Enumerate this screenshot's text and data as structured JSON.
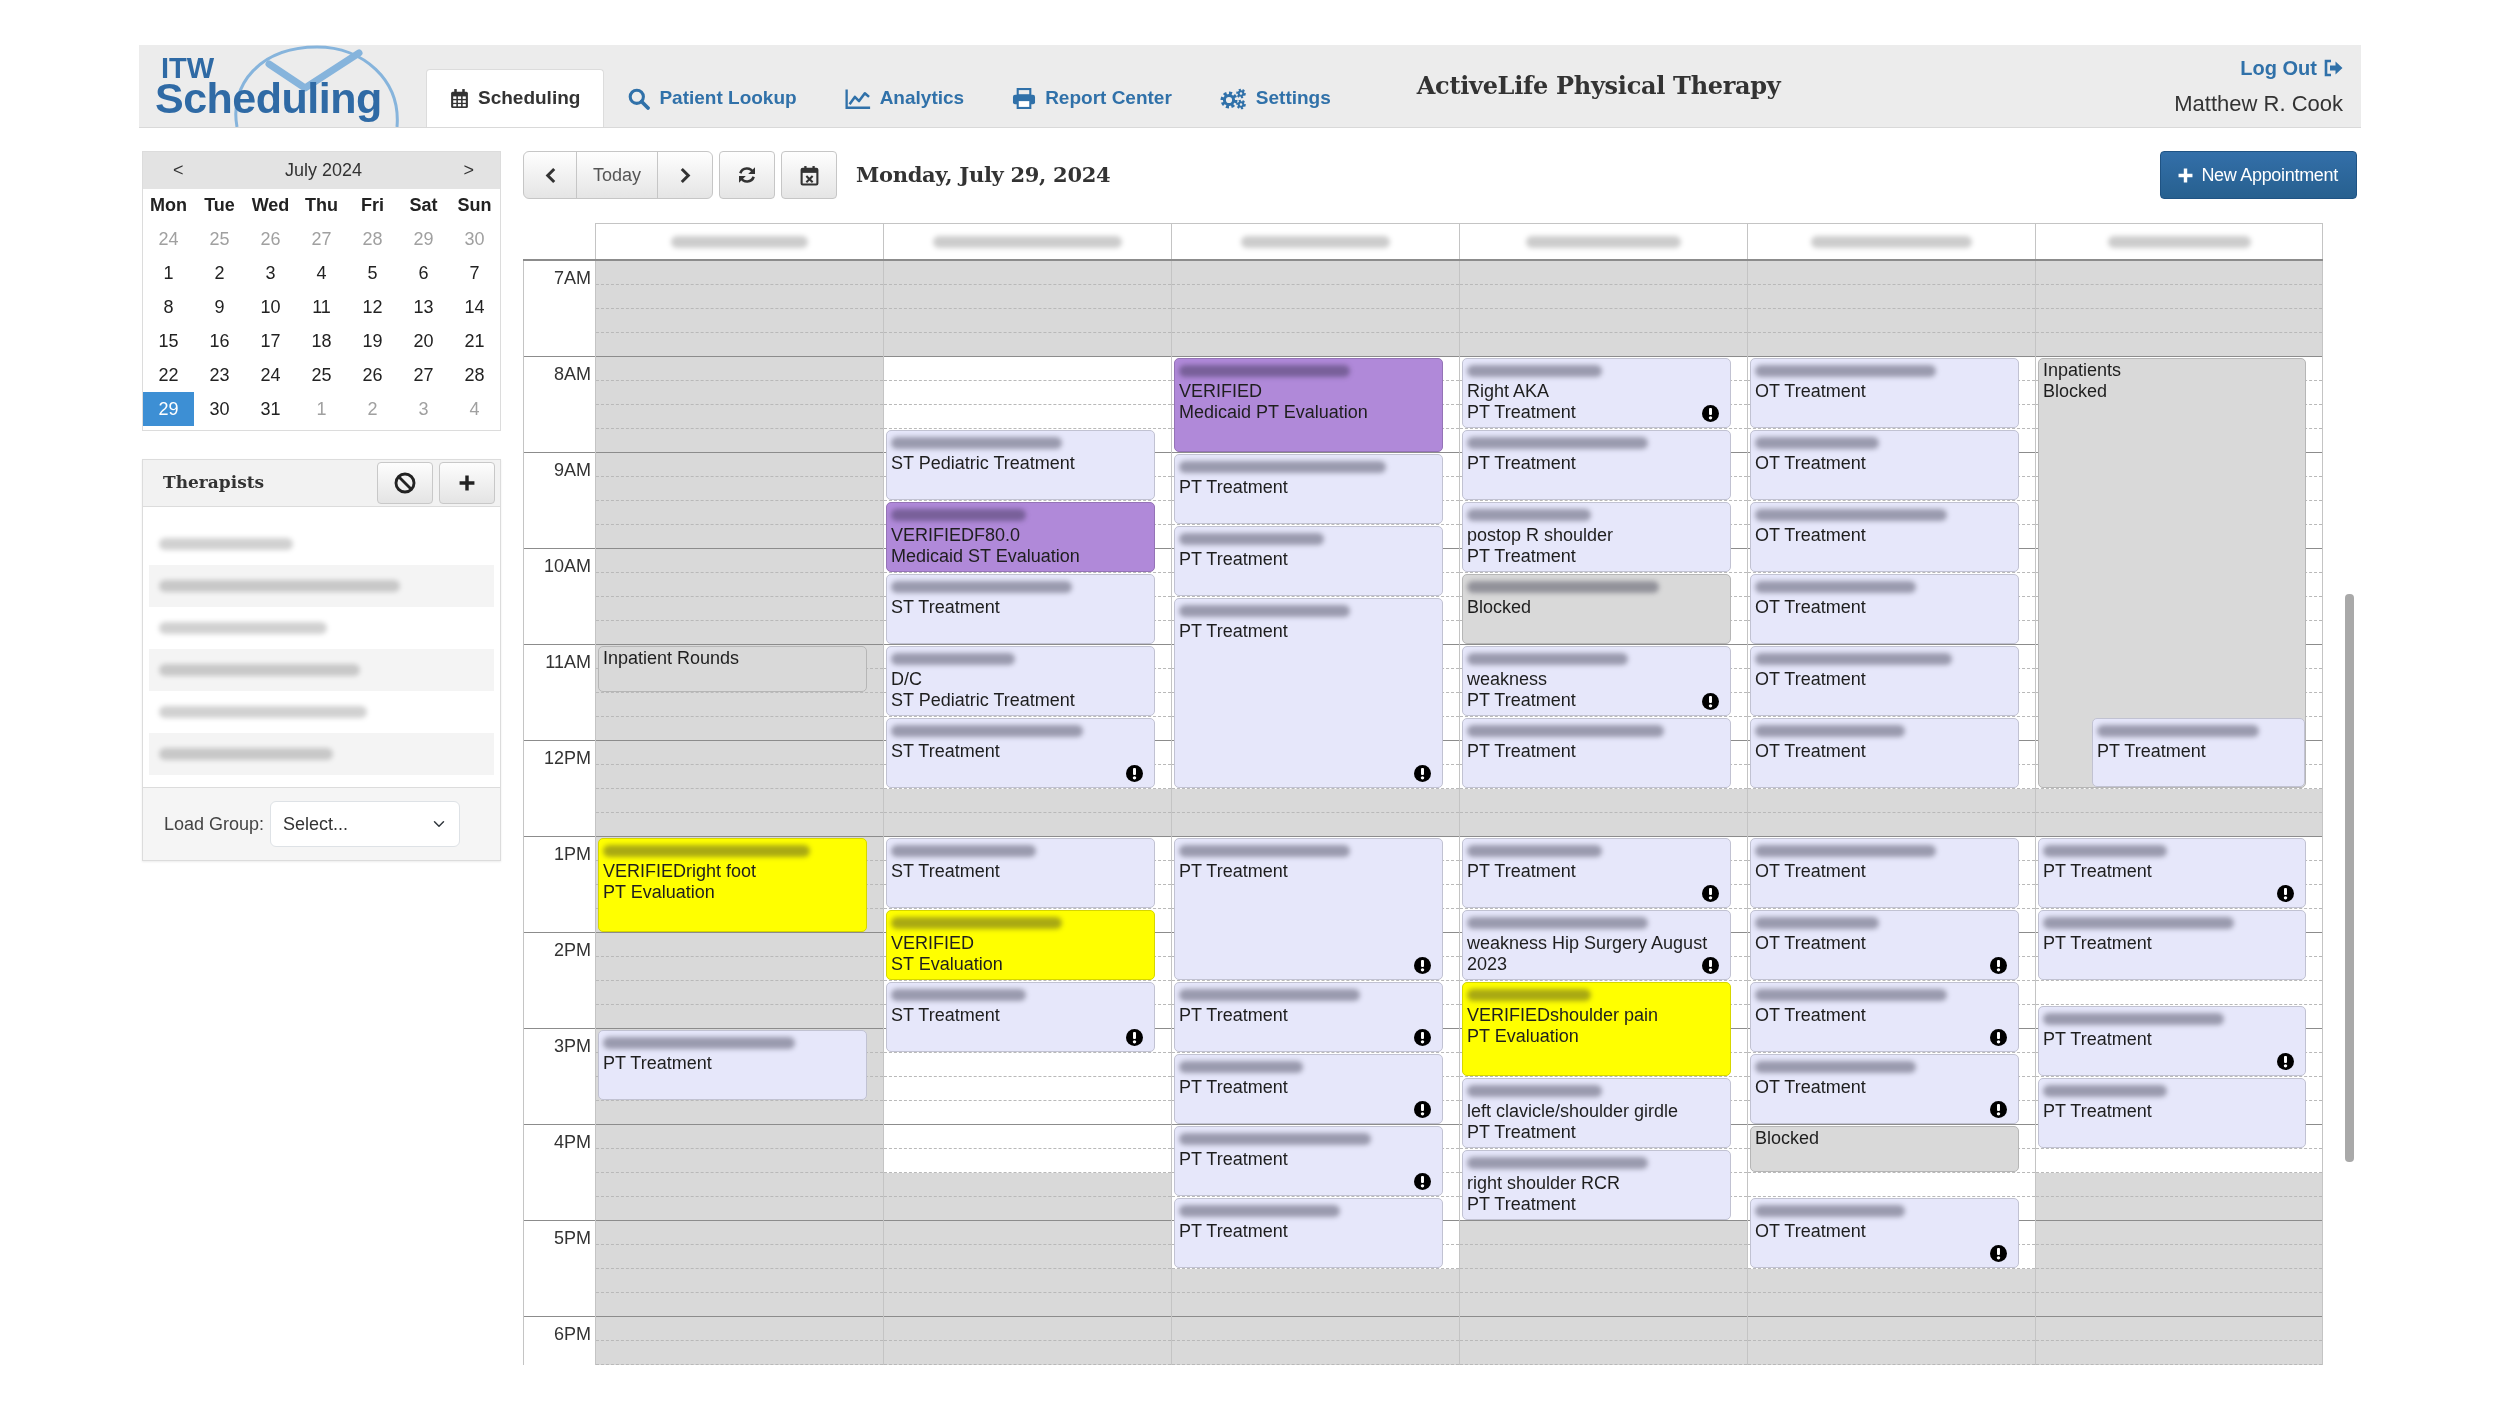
{
  "header": {
    "logo": {
      "small": "ITW",
      "large": "Scheduling"
    },
    "tabs": [
      {
        "label": "Scheduling",
        "selected": true
      },
      {
        "label": "Patient Lookup",
        "selected": false
      },
      {
        "label": "Analytics",
        "selected": false
      },
      {
        "label": "Report Center",
        "selected": false
      },
      {
        "label": "Settings",
        "selected": false
      }
    ],
    "title": "ActiveLife Physical Therapy",
    "logout": "Log Out",
    "user": "Matthew R. Cook"
  },
  "mini_calendar": {
    "prev": "<",
    "month": "July 2024",
    "next": ">",
    "weekdays": [
      "Mon",
      "Tue",
      "Wed",
      "Thu",
      "Fri",
      "Sat",
      "Sun"
    ],
    "weeks": [
      [
        {
          "day": "24",
          "other_month": true,
          "selected": false
        },
        {
          "day": "25",
          "other_month": true,
          "selected": false
        },
        {
          "day": "26",
          "other_month": true,
          "selected": false
        },
        {
          "day": "27",
          "other_month": true,
          "selected": false
        },
        {
          "day": "28",
          "other_month": true,
          "selected": false
        },
        {
          "day": "29",
          "other_month": true,
          "selected": false
        },
        {
          "day": "30",
          "other_month": true,
          "selected": false
        }
      ],
      [
        {
          "day": "1",
          "other_month": false,
          "selected": false
        },
        {
          "day": "2",
          "other_month": false,
          "selected": false
        },
        {
          "day": "3",
          "other_month": false,
          "selected": false
        },
        {
          "day": "4",
          "other_month": false,
          "selected": false
        },
        {
          "day": "5",
          "other_month": false,
          "selected": false
        },
        {
          "day": "6",
          "other_month": false,
          "selected": false
        },
        {
          "day": "7",
          "other_month": false,
          "selected": false
        }
      ],
      [
        {
          "day": "8",
          "other_month": false,
          "selected": false
        },
        {
          "day": "9",
          "other_month": false,
          "selected": false
        },
        {
          "day": "10",
          "other_month": false,
          "selected": false
        },
        {
          "day": "11",
          "other_month": false,
          "selected": false
        },
        {
          "day": "12",
          "other_month": false,
          "selected": false
        },
        {
          "day": "13",
          "other_month": false,
          "selected": false
        },
        {
          "day": "14",
          "other_month": false,
          "selected": false
        }
      ],
      [
        {
          "day": "15",
          "other_month": false,
          "selected": false
        },
        {
          "day": "16",
          "other_month": false,
          "selected": false
        },
        {
          "day": "17",
          "other_month": false,
          "selected": false
        },
        {
          "day": "18",
          "other_month": false,
          "selected": false
        },
        {
          "day": "19",
          "other_month": false,
          "selected": false
        },
        {
          "day": "20",
          "other_month": false,
          "selected": false
        },
        {
          "day": "21",
          "other_month": false,
          "selected": false
        }
      ],
      [
        {
          "day": "22",
          "other_month": false,
          "selected": false
        },
        {
          "day": "23",
          "other_month": false,
          "selected": false
        },
        {
          "day": "24",
          "other_month": false,
          "selected": false
        },
        {
          "day": "25",
          "other_month": false,
          "selected": false
        },
        {
          "day": "26",
          "other_month": false,
          "selected": false
        },
        {
          "day": "27",
          "other_month": false,
          "selected": false
        },
        {
          "day": "28",
          "other_month": false,
          "selected": false
        }
      ],
      [
        {
          "day": "29",
          "other_month": false,
          "selected": true
        },
        {
          "day": "30",
          "other_month": false,
          "selected": false
        },
        {
          "day": "31",
          "other_month": false,
          "selected": false
        },
        {
          "day": "1",
          "other_month": true,
          "selected": false
        },
        {
          "day": "2",
          "other_month": true,
          "selected": false
        },
        {
          "day": "3",
          "other_month": true,
          "selected": false
        },
        {
          "day": "4",
          "other_month": true,
          "selected": false
        }
      ]
    ]
  },
  "therapists": {
    "title": "Therapists",
    "items": [
      {
        "name_blurred": true
      },
      {
        "name_blurred": true
      },
      {
        "name_blurred": true
      },
      {
        "name_blurred": true
      },
      {
        "name_blurred": true
      },
      {
        "name_blurred": true
      }
    ],
    "load_group": {
      "label": "Load Group:",
      "value": "Select..."
    }
  },
  "toolbar": {
    "today": "Today",
    "date": "Monday, July 29, 2024",
    "new_appointment": "New Appointment"
  },
  "schedule": {
    "hours": [
      "7AM",
      "8AM",
      "9AM",
      "10AM",
      "11AM",
      "12PM",
      "1PM",
      "2PM",
      "3PM",
      "4PM",
      "5PM",
      "6PM"
    ],
    "columns": [
      {
        "header_blurred": true,
        "slots": [
          {
            "kind": "closed"
          },
          {
            "kind": "closed"
          },
          {
            "kind": "closed"
          },
          {
            "kind": "closed"
          },
          {
            "kind": "closed"
          },
          {
            "kind": "closed"
          },
          {
            "kind": "closed"
          },
          {
            "kind": "closed"
          },
          {
            "kind": "closed"
          },
          {
            "kind": "closed"
          },
          {
            "kind": "closed"
          },
          {
            "kind": "closed"
          },
          {
            "kind": "closed"
          },
          {
            "kind": "closed"
          },
          {
            "kind": "closed"
          },
          {
            "kind": "closed"
          },
          {
            "kind": "appointment",
            "color": "#d9d9d9",
            "name_blurred": false,
            "alert": false,
            "lines": [
              "Inpatient Rounds"
            ],
            "slots": [
              {
                "kind": "closed"
              },
              {
                "kind": "closed"
              }
            ]
          },
          {
            "kind": "closed"
          },
          {
            "kind": "closed"
          },
          {
            "kind": "closed"
          },
          {
            "kind": "closed"
          },
          {
            "kind": "closed"
          },
          {
            "kind": "closed"
          },
          {
            "kind": "appointment",
            "color": "#ffff00",
            "name_blurred": true,
            "alert": false,
            "lines": [
              "VERIFIEDright foot",
              "PT Evaluation"
            ],
            "slots": [
              {
                "kind": "closed"
              },
              {
                "kind": "closed"
              },
              {
                "kind": "closed"
              },
              {
                "kind": "closed"
              }
            ]
          },
          {
            "kind": "closed"
          },
          {
            "kind": "closed"
          },
          {
            "kind": "closed"
          },
          {
            "kind": "closed"
          },
          {
            "kind": "appointment",
            "color": "#e6e7fa",
            "name_blurred": true,
            "alert": false,
            "lines": [
              "PT Treatment"
            ],
            "slots": [
              {
                "kind": "closed"
              },
              {
                "kind": "closed"
              },
              {
                "kind": "closed"
              }
            ]
          },
          {
            "kind": "closed"
          },
          {
            "kind": "closed"
          },
          {
            "kind": "closed"
          },
          {
            "kind": "closed"
          },
          {
            "kind": "closed"
          },
          {
            "kind": "closed"
          },
          {
            "kind": "closed"
          },
          {
            "kind": "closed"
          },
          {
            "kind": "closed"
          },
          {
            "kind": "closed"
          },
          {
            "kind": "closed"
          }
        ]
      },
      {
        "header_blurred": true,
        "slots": [
          {
            "kind": "closed"
          },
          {
            "kind": "closed"
          },
          {
            "kind": "closed"
          },
          {
            "kind": "closed"
          },
          {
            "kind": "open"
          },
          {
            "kind": "open"
          },
          {
            "kind": "open"
          },
          {
            "kind": "appointment",
            "color": "#e6e7fa",
            "name_blurred": true,
            "alert": false,
            "lines": [
              "ST Pediatric Treatment"
            ],
            "slots": [
              {
                "kind": "open"
              },
              {
                "kind": "open"
              },
              {
                "kind": "open"
              }
            ]
          },
          {
            "kind": "appointment",
            "color": "#b089d9",
            "name_blurred": true,
            "alert": false,
            "lines": [
              "VERIFIEDF80.0",
              "Medicaid ST Evaluation"
            ],
            "slots": [
              {
                "kind": "open"
              },
              {
                "kind": "open"
              },
              {
                "kind": "open"
              }
            ]
          },
          {
            "kind": "appointment",
            "color": "#e6e7fa",
            "name_blurred": true,
            "alert": false,
            "lines": [
              "ST Treatment"
            ],
            "slots": [
              {
                "kind": "open"
              },
              {
                "kind": "open"
              },
              {
                "kind": "open"
              }
            ]
          },
          {
            "kind": "appointment",
            "color": "#e6e7fa",
            "name_blurred": true,
            "alert": false,
            "lines": [
              "D/C",
              "ST Pediatric Treatment"
            ],
            "slots": [
              {
                "kind": "open"
              },
              {
                "kind": "open"
              },
              {
                "kind": "open"
              }
            ]
          },
          {
            "kind": "appointment",
            "color": "#e6e7fa",
            "name_blurred": true,
            "alert": true,
            "lines": [
              "ST Treatment"
            ],
            "slots": [
              {
                "kind": "open"
              },
              {
                "kind": "open"
              },
              {
                "kind": "open"
              }
            ]
          },
          {
            "kind": "closed"
          },
          {
            "kind": "closed"
          },
          {
            "kind": "appointment",
            "color": "#e6e7fa",
            "name_blurred": true,
            "alert": false,
            "lines": [
              "ST Treatment"
            ],
            "slots": [
              {
                "kind": "open"
              },
              {
                "kind": "open"
              },
              {
                "kind": "open"
              }
            ]
          },
          {
            "kind": "appointment",
            "color": "#ffff00",
            "name_blurred": true,
            "alert": false,
            "lines": [
              "VERIFIED",
              "ST Evaluation"
            ],
            "slots": [
              {
                "kind": "open"
              },
              {
                "kind": "open"
              },
              {
                "kind": "open"
              }
            ]
          },
          {
            "kind": "appointment",
            "color": "#e6e7fa",
            "name_blurred": true,
            "alert": true,
            "lines": [
              "ST Treatment"
            ],
            "slots": [
              {
                "kind": "open"
              },
              {
                "kind": "open"
              },
              {
                "kind": "open"
              }
            ]
          },
          {
            "kind": "open"
          },
          {
            "kind": "open"
          },
          {
            "kind": "open"
          },
          {
            "kind": "open"
          },
          {
            "kind": "open"
          },
          {
            "kind": "closed"
          },
          {
            "kind": "closed"
          },
          {
            "kind": "closed"
          },
          {
            "kind": "closed"
          },
          {
            "kind": "closed"
          },
          {
            "kind": "closed"
          },
          {
            "kind": "closed"
          },
          {
            "kind": "closed"
          }
        ]
      },
      {
        "header_blurred": true,
        "slots": [
          {
            "kind": "closed"
          },
          {
            "kind": "closed"
          },
          {
            "kind": "closed"
          },
          {
            "kind": "closed"
          },
          {
            "kind": "appointment",
            "color": "#b089d9",
            "name_blurred": true,
            "alert": false,
            "lines": [
              "VERIFIED",
              "Medicaid PT Evaluation"
            ],
            "slots": [
              {
                "kind": "open"
              },
              {
                "kind": "open"
              },
              {
                "kind": "open"
              },
              {
                "kind": "open"
              }
            ]
          },
          {
            "kind": "appointment",
            "color": "#e6e7fa",
            "name_blurred": true,
            "alert": false,
            "lines": [
              "PT Treatment"
            ],
            "slots": [
              {
                "kind": "open"
              },
              {
                "kind": "open"
              },
              {
                "kind": "open"
              }
            ]
          },
          {
            "kind": "appointment",
            "color": "#e6e7fa",
            "name_blurred": true,
            "alert": false,
            "lines": [
              "PT Treatment"
            ],
            "slots": [
              {
                "kind": "open"
              },
              {
                "kind": "open"
              },
              {
                "kind": "open"
              }
            ]
          },
          {
            "kind": "appointment",
            "color": "#e6e7fa",
            "name_blurred": true,
            "alert": true,
            "lines": [
              "PT Treatment"
            ],
            "slots": [
              {
                "kind": "open"
              },
              {
                "kind": "open"
              },
              {
                "kind": "open"
              },
              {
                "kind": "open"
              },
              {
                "kind": "open"
              },
              {
                "kind": "open"
              },
              {
                "kind": "open"
              },
              {
                "kind": "open"
              }
            ]
          },
          {
            "kind": "closed"
          },
          {
            "kind": "closed"
          },
          {
            "kind": "appointment",
            "color": "#e6e7fa",
            "name_blurred": true,
            "alert": true,
            "lines": [
              "PT Treatment"
            ],
            "slots": [
              {
                "kind": "open"
              },
              {
                "kind": "open"
              },
              {
                "kind": "open"
              },
              {
                "kind": "open"
              },
              {
                "kind": "open"
              },
              {
                "kind": "open"
              }
            ]
          },
          {
            "kind": "appointment",
            "color": "#e6e7fa",
            "name_blurred": true,
            "alert": true,
            "lines": [
              "PT Treatment"
            ],
            "slots": [
              {
                "kind": "open"
              },
              {
                "kind": "open"
              },
              {
                "kind": "open"
              }
            ]
          },
          {
            "kind": "appointment",
            "color": "#e6e7fa",
            "name_blurred": true,
            "alert": true,
            "lines": [
              "PT Treatment"
            ],
            "slots": [
              {
                "kind": "open"
              },
              {
                "kind": "open"
              },
              {
                "kind": "open"
              }
            ]
          },
          {
            "kind": "appointment",
            "color": "#e6e7fa",
            "name_blurred": true,
            "alert": true,
            "lines": [
              "PT Treatment"
            ],
            "slots": [
              {
                "kind": "open"
              },
              {
                "kind": "open"
              },
              {
                "kind": "open"
              }
            ]
          },
          {
            "kind": "appointment",
            "color": "#e6e7fa",
            "name_blurred": true,
            "alert": false,
            "lines": [
              "PT Treatment"
            ],
            "slots": [
              {
                "kind": "open"
              },
              {
                "kind": "open"
              },
              {
                "kind": "open"
              }
            ]
          },
          {
            "kind": "closed"
          },
          {
            "kind": "closed"
          },
          {
            "kind": "closed"
          },
          {
            "kind": "closed"
          }
        ]
      },
      {
        "header_blurred": true,
        "slots": [
          {
            "kind": "closed"
          },
          {
            "kind": "closed"
          },
          {
            "kind": "closed"
          },
          {
            "kind": "closed"
          },
          {
            "kind": "appointment",
            "color": "#e6e7fa",
            "name_blurred": true,
            "alert": true,
            "lines": [
              "Right AKA",
              "PT Treatment"
            ],
            "slots": [
              {
                "kind": "open"
              },
              {
                "kind": "open"
              },
              {
                "kind": "open"
              }
            ]
          },
          {
            "kind": "appointment",
            "color": "#e6e7fa",
            "name_blurred": true,
            "alert": false,
            "lines": [
              "PT Treatment"
            ],
            "slots": [
              {
                "kind": "open"
              },
              {
                "kind": "open"
              },
              {
                "kind": "open"
              }
            ]
          },
          {
            "kind": "appointment",
            "color": "#e6e7fa",
            "name_blurred": true,
            "alert": false,
            "lines": [
              "postop R shoulder",
              "PT Treatment"
            ],
            "slots": [
              {
                "kind": "open"
              },
              {
                "kind": "open"
              },
              {
                "kind": "open"
              }
            ]
          },
          {
            "kind": "appointment",
            "color": "#d9d9d9",
            "name_blurred": true,
            "alert": false,
            "lines": [
              "Blocked"
            ],
            "slots": [
              {
                "kind": "open"
              },
              {
                "kind": "open"
              },
              {
                "kind": "open"
              }
            ]
          },
          {
            "kind": "appointment",
            "color": "#e6e7fa",
            "name_blurred": true,
            "alert": true,
            "lines": [
              "weakness",
              "PT Treatment"
            ],
            "slots": [
              {
                "kind": "open"
              },
              {
                "kind": "open"
              },
              {
                "kind": "open"
              }
            ]
          },
          {
            "kind": "appointment",
            "color": "#e6e7fa",
            "name_blurred": true,
            "alert": false,
            "lines": [
              "PT Treatment"
            ],
            "slots": [
              {
                "kind": "open"
              },
              {
                "kind": "open"
              },
              {
                "kind": "open"
              }
            ]
          },
          {
            "kind": "closed"
          },
          {
            "kind": "closed"
          },
          {
            "kind": "appointment",
            "color": "#e6e7fa",
            "name_blurred": true,
            "alert": true,
            "lines": [
              "PT Treatment"
            ],
            "slots": [
              {
                "kind": "open"
              },
              {
                "kind": "open"
              },
              {
                "kind": "open"
              }
            ]
          },
          {
            "kind": "appointment",
            "color": "#e6e7fa",
            "name_blurred": true,
            "alert": true,
            "lines": [
              "weakness Hip Surgery August 2023"
            ],
            "slots": [
              {
                "kind": "open"
              },
              {
                "kind": "open"
              },
              {
                "kind": "open"
              }
            ]
          },
          {
            "kind": "appointment",
            "color": "#ffff00",
            "name_blurred": true,
            "alert": false,
            "lines": [
              "VERIFIEDshoulder pain",
              "PT Evaluation"
            ],
            "slots": [
              {
                "kind": "open"
              },
              {
                "kind": "open"
              },
              {
                "kind": "open"
              },
              {
                "kind": "open"
              }
            ]
          },
          {
            "kind": "appointment",
            "color": "#e6e7fa",
            "name_blurred": true,
            "alert": false,
            "lines": [
              "left clavicle/shoulder girdle",
              "PT Treatment"
            ],
            "slots": [
              {
                "kind": "open"
              },
              {
                "kind": "open"
              },
              {
                "kind": "open"
              }
            ]
          },
          {
            "kind": "appointment",
            "color": "#e6e7fa",
            "name_blurred": true,
            "alert": false,
            "lines": [
              "right shoulder RCR",
              "PT Treatment"
            ],
            "slots": [
              {
                "kind": "open"
              },
              {
                "kind": "open"
              },
              {
                "kind": "open"
              }
            ]
          },
          {
            "kind": "closed"
          },
          {
            "kind": "closed"
          },
          {
            "kind": "closed"
          },
          {
            "kind": "closed"
          },
          {
            "kind": "closed"
          },
          {
            "kind": "closed"
          }
        ]
      },
      {
        "header_blurred": true,
        "slots": [
          {
            "kind": "closed"
          },
          {
            "kind": "closed"
          },
          {
            "kind": "closed"
          },
          {
            "kind": "closed"
          },
          {
            "kind": "appointment",
            "color": "#e6e7fa",
            "name_blurred": true,
            "alert": false,
            "lines": [
              "OT Treatment"
            ],
            "slots": [
              {
                "kind": "open"
              },
              {
                "kind": "open"
              },
              {
                "kind": "open"
              }
            ]
          },
          {
            "kind": "appointment",
            "color": "#e6e7fa",
            "name_blurred": true,
            "alert": false,
            "lines": [
              "OT Treatment"
            ],
            "slots": [
              {
                "kind": "open"
              },
              {
                "kind": "open"
              },
              {
                "kind": "open"
              }
            ]
          },
          {
            "kind": "appointment",
            "color": "#e6e7fa",
            "name_blurred": true,
            "alert": false,
            "lines": [
              "OT Treatment"
            ],
            "slots": [
              {
                "kind": "open"
              },
              {
                "kind": "open"
              },
              {
                "kind": "open"
              }
            ]
          },
          {
            "kind": "appointment",
            "color": "#e6e7fa",
            "name_blurred": true,
            "alert": false,
            "lines": [
              "OT Treatment"
            ],
            "slots": [
              {
                "kind": "open"
              },
              {
                "kind": "open"
              },
              {
                "kind": "open"
              }
            ]
          },
          {
            "kind": "appointment",
            "color": "#e6e7fa",
            "name_blurred": true,
            "alert": false,
            "lines": [
              "OT Treatment"
            ],
            "slots": [
              {
                "kind": "open"
              },
              {
                "kind": "open"
              },
              {
                "kind": "open"
              }
            ]
          },
          {
            "kind": "appointment",
            "color": "#e6e7fa",
            "name_blurred": true,
            "alert": false,
            "lines": [
              "OT Treatment"
            ],
            "slots": [
              {
                "kind": "open"
              },
              {
                "kind": "open"
              },
              {
                "kind": "open"
              }
            ]
          },
          {
            "kind": "closed"
          },
          {
            "kind": "closed"
          },
          {
            "kind": "appointment",
            "color": "#e6e7fa",
            "name_blurred": true,
            "alert": false,
            "lines": [
              "OT Treatment"
            ],
            "slots": [
              {
                "kind": "open"
              },
              {
                "kind": "open"
              },
              {
                "kind": "open"
              }
            ]
          },
          {
            "kind": "appointment",
            "color": "#e6e7fa",
            "name_blurred": true,
            "alert": true,
            "lines": [
              "OT Treatment"
            ],
            "slots": [
              {
                "kind": "open"
              },
              {
                "kind": "open"
              },
              {
                "kind": "open"
              }
            ]
          },
          {
            "kind": "appointment",
            "color": "#e6e7fa",
            "name_blurred": true,
            "alert": true,
            "lines": [
              "OT Treatment"
            ],
            "slots": [
              {
                "kind": "open"
              },
              {
                "kind": "open"
              },
              {
                "kind": "open"
              }
            ]
          },
          {
            "kind": "appointment",
            "color": "#e6e7fa",
            "name_blurred": true,
            "alert": true,
            "lines": [
              "OT Treatment"
            ],
            "slots": [
              {
                "kind": "open"
              },
              {
                "kind": "open"
              },
              {
                "kind": "open"
              }
            ]
          },
          {
            "kind": "appointment",
            "color": "#d9d9d9",
            "name_blurred": false,
            "alert": false,
            "lines": [
              "Blocked"
            ],
            "slots": [
              {
                "kind": "open"
              },
              {
                "kind": "open"
              }
            ]
          },
          {
            "kind": "open"
          },
          {
            "kind": "appointment",
            "color": "#e6e7fa",
            "name_blurred": true,
            "alert": true,
            "lines": [
              "OT Treatment"
            ],
            "slots": [
              {
                "kind": "open"
              },
              {
                "kind": "open"
              },
              {
                "kind": "open"
              }
            ]
          },
          {
            "kind": "closed"
          },
          {
            "kind": "closed"
          },
          {
            "kind": "closed"
          },
          {
            "kind": "closed"
          }
        ]
      },
      {
        "header_blurred": true,
        "slots": [
          {
            "kind": "closed"
          },
          {
            "kind": "closed"
          },
          {
            "kind": "closed"
          },
          {
            "kind": "closed"
          },
          {
            "kind": "appointment",
            "color": "#d9d9d9",
            "name_blurred": false,
            "alert": false,
            "lines": [
              "Inpatients",
              "Blocked"
            ],
            "slots": [
              {
                "kind": "open"
              },
              {
                "kind": "open"
              },
              {
                "kind": "open"
              },
              {
                "kind": "open"
              },
              {
                "kind": "open"
              },
              {
                "kind": "open"
              },
              {
                "kind": "open"
              },
              {
                "kind": "open"
              },
              {
                "kind": "open"
              },
              {
                "kind": "open"
              },
              {
                "kind": "open"
              },
              {
                "kind": "open"
              },
              {
                "kind": "open"
              },
              {
                "kind": "open"
              },
              {
                "kind": "open"
              },
              {
                "kind": "open",
                "appointment": {
                  "color": "#e6e7fa",
                  "name_blurred": true,
                  "alert": false,
                  "lines": [
                    "PT Treatment"
                  ]
                }
              },
              {
                "kind": "open"
              },
              {
                "kind": "open"
              }
            ]
          },
          {
            "kind": "closed"
          },
          {
            "kind": "closed"
          },
          {
            "kind": "appointment",
            "color": "#e6e7fa",
            "name_blurred": true,
            "alert": true,
            "lines": [
              "PT Treatment"
            ],
            "slots": [
              {
                "kind": "open"
              },
              {
                "kind": "open"
              },
              {
                "kind": "open"
              }
            ]
          },
          {
            "kind": "appointment",
            "color": "#e6e7fa",
            "name_blurred": true,
            "alert": false,
            "lines": [
              "PT Treatment"
            ],
            "slots": [
              {
                "kind": "open"
              },
              {
                "kind": "open"
              },
              {
                "kind": "open"
              }
            ]
          },
          {
            "kind": "open"
          },
          {
            "kind": "appointment",
            "color": "#e6e7fa",
            "name_blurred": true,
            "alert": true,
            "lines": [
              "PT Treatment"
            ],
            "slots": [
              {
                "kind": "open"
              },
              {
                "kind": "open"
              },
              {
                "kind": "open"
              }
            ]
          },
          {
            "kind": "appointment",
            "color": "#e6e7fa",
            "name_blurred": true,
            "alert": false,
            "lines": [
              "PT Treatment"
            ],
            "slots": [
              {
                "kind": "open"
              },
              {
                "kind": "open"
              },
              {
                "kind": "open"
              }
            ]
          },
          {
            "kind": "open"
          },
          {
            "kind": "closed"
          },
          {
            "kind": "closed"
          },
          {
            "kind": "closed"
          },
          {
            "kind": "closed"
          },
          {
            "kind": "closed"
          },
          {
            "kind": "closed"
          },
          {
            "kind": "closed"
          },
          {
            "kind": "closed"
          }
        ]
      }
    ]
  }
}
